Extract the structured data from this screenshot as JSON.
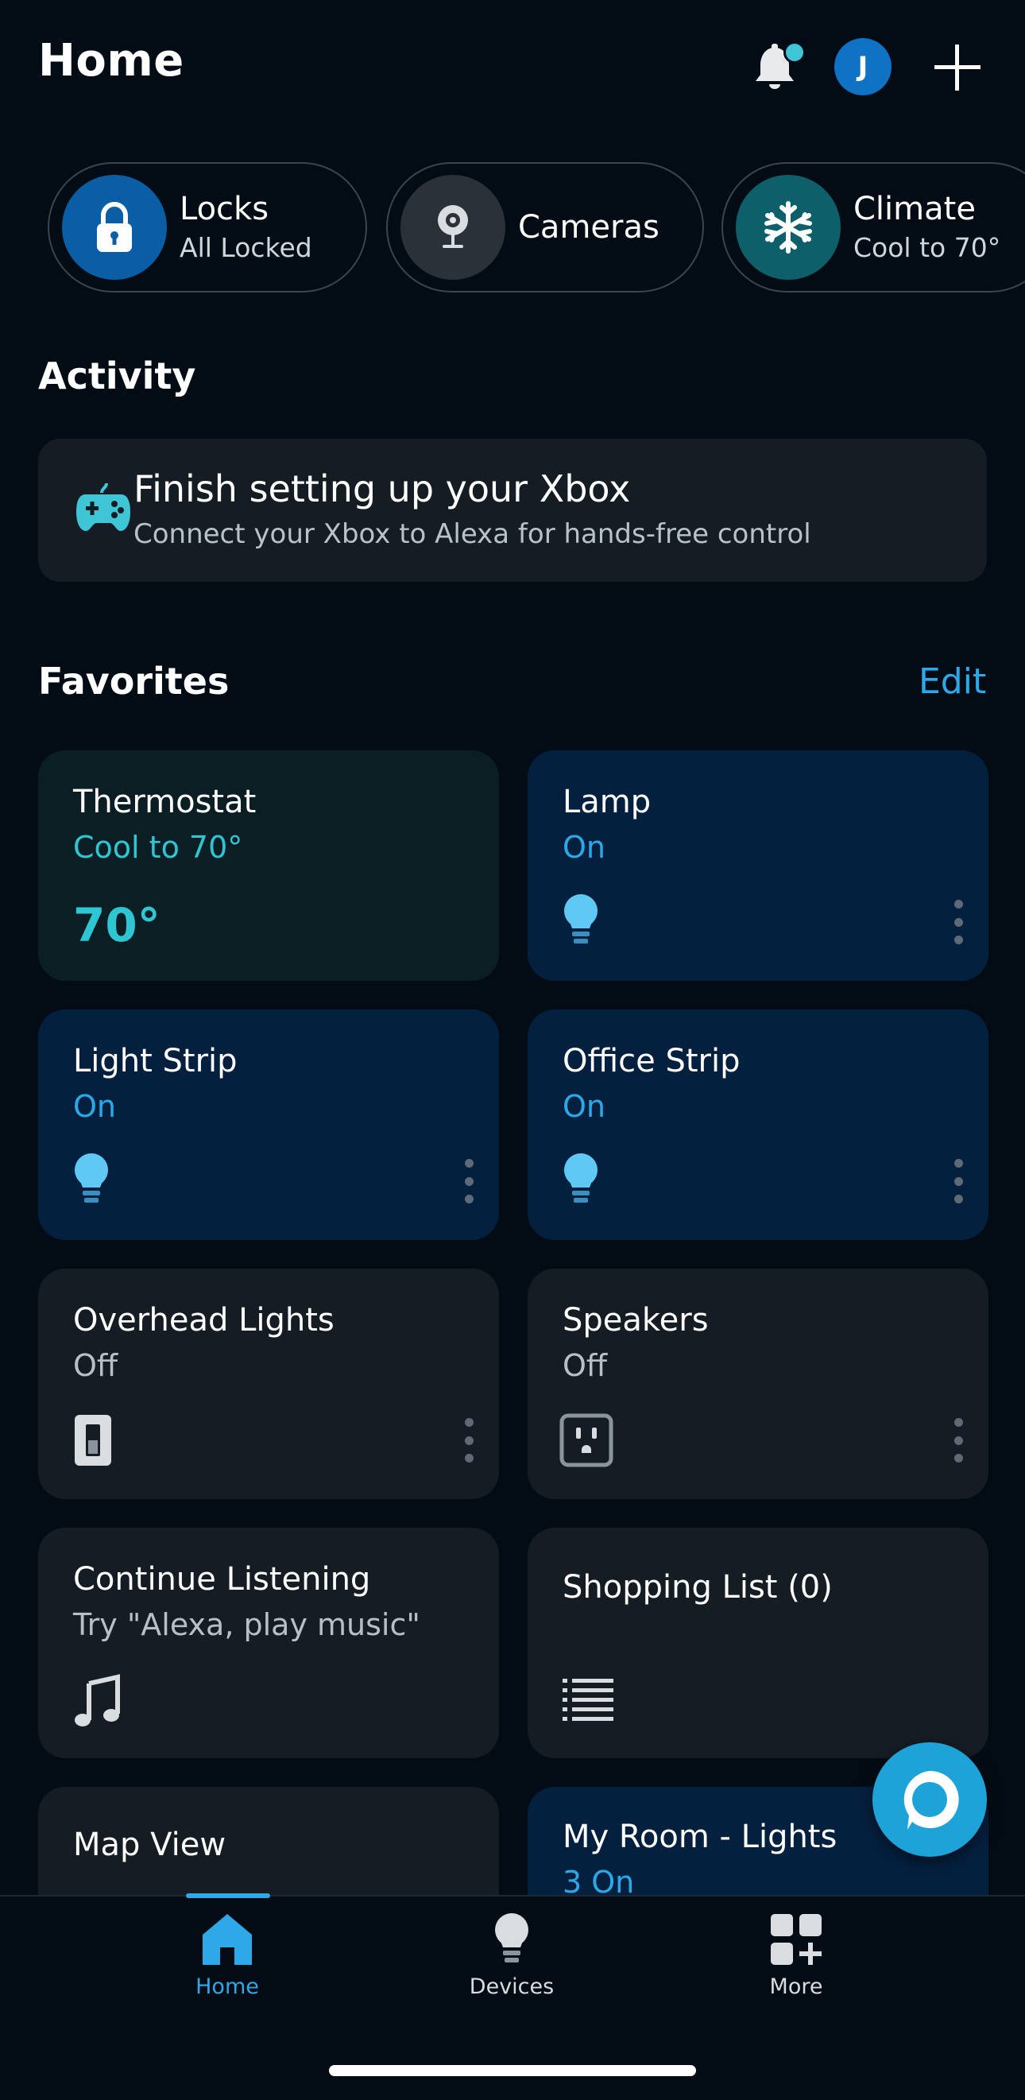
{
  "header": {
    "title": "Home"
  },
  "quick_pills": [
    {
      "title": "Locks",
      "subtitle": "All Locked",
      "icon": "lock-icon",
      "color": "#0a5ea6"
    },
    {
      "title": "Cameras",
      "subtitle": "",
      "icon": "camera-icon",
      "color": "#2a3138"
    },
    {
      "title": "Climate",
      "subtitle": "Cool to 70°",
      "icon": "snowflake-icon",
      "color": "#0d5f6a"
    }
  ],
  "activity": {
    "heading": "Activity",
    "card_title": "Finish setting up your Xbox",
    "card_subtitle": "Connect your Xbox to Alexa for hands-free control",
    "icon": "gamepad-icon"
  },
  "favorites": {
    "heading": "Favorites",
    "edit_label": "Edit",
    "tiles": [
      {
        "title": "Thermostat",
        "status": "Cool to 70°",
        "value": "70°",
        "icon": "thermostat"
      },
      {
        "title": "Lamp",
        "status": "On",
        "icon": "bulb-icon"
      },
      {
        "title": "Light Strip",
        "status": "On",
        "icon": "bulb-icon"
      },
      {
        "title": "Office Strip",
        "status": "On",
        "icon": "bulb-icon"
      },
      {
        "title": "Overhead Lights",
        "status": "Off",
        "icon": "switch-icon"
      },
      {
        "title": "Speakers",
        "status": "Off",
        "icon": "outlet-icon"
      },
      {
        "title": "Continue Listening",
        "status": "Try \"Alexa, play music\"",
        "icon": "music-note-icon"
      },
      {
        "title": "Shopping List (0)",
        "status": "",
        "icon": "list-icon"
      },
      {
        "title": "Map View",
        "status": ""
      },
      {
        "title": "My Room - Lights",
        "status": "3 On"
      }
    ]
  },
  "nav": {
    "items": [
      {
        "label": "Home",
        "icon": "home-icon",
        "active": true
      },
      {
        "label": "Devices",
        "icon": "bulb-icon",
        "active": false
      },
      {
        "label": "More",
        "icon": "grid-plus-icon",
        "active": false
      }
    ]
  },
  "colors": {
    "accent": "#2ea8e6",
    "background": "#030c14",
    "tile_dark": "#151c23",
    "tile_blue": "#04203f"
  }
}
